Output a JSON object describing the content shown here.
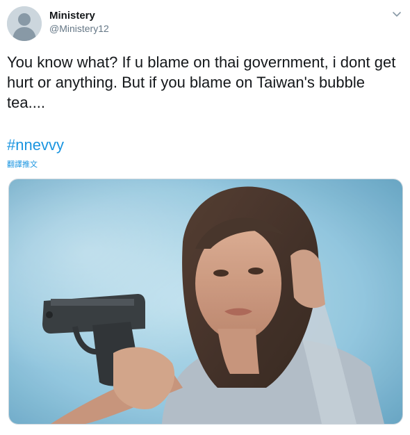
{
  "author": {
    "display_name": "Ministery",
    "handle": "@Ministery12"
  },
  "tweet": {
    "text": "You know what? If u blame on thai government, i dont get hurt or anything. But if you blame on Taiwan's bubble tea....",
    "hashtag": "#nnevvy",
    "translate_label": "翻譯推文"
  },
  "icons": {
    "menu": "chevron-down-icon",
    "avatar": "default-avatar-icon"
  },
  "colors": {
    "link": "#1b95e0",
    "secondary_text": "#657786",
    "media_background": "#8cc3dc"
  }
}
